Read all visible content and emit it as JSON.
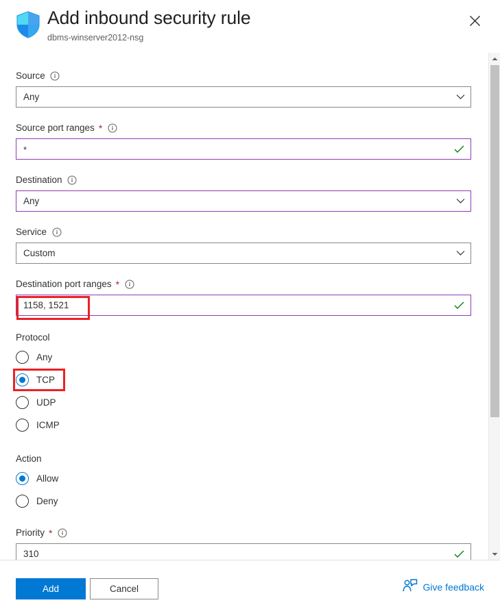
{
  "header": {
    "title": "Add inbound security rule",
    "subtitle": "dbms-winserver2012-nsg",
    "shield_icon": "shield-icon",
    "close_icon": "close-icon"
  },
  "form": {
    "source": {
      "label": "Source",
      "info_icon": "info-icon",
      "value": "Any",
      "required": false,
      "accent": false,
      "chevron_icon": "chevron-down-icon"
    },
    "source_port_ranges": {
      "label": "Source port ranges",
      "required_marker": "*",
      "info_icon": "info-icon",
      "value": "*",
      "required": true,
      "accent": true,
      "valid_icon": "checkmark-icon"
    },
    "destination": {
      "label": "Destination",
      "info_icon": "info-icon",
      "value": "Any",
      "required": false,
      "accent": true,
      "chevron_icon": "chevron-down-icon"
    },
    "service": {
      "label": "Service",
      "info_icon": "info-icon",
      "value": "Custom",
      "required": false,
      "accent": false,
      "chevron_icon": "chevron-down-icon"
    },
    "destination_port_ranges": {
      "label": "Destination port ranges",
      "required_marker": "*",
      "info_icon": "info-icon",
      "value": "1158, 1521",
      "required": true,
      "accent": true,
      "valid_icon": "checkmark-icon",
      "highlighted": true
    },
    "protocol": {
      "label": "Protocol",
      "selected": "TCP",
      "options": [
        {
          "label": "Any",
          "selected": false,
          "highlighted": false
        },
        {
          "label": "TCP",
          "selected": true,
          "highlighted": true
        },
        {
          "label": "UDP",
          "selected": false,
          "highlighted": false
        },
        {
          "label": "ICMP",
          "selected": false,
          "highlighted": false
        }
      ]
    },
    "action": {
      "label": "Action",
      "selected": "Allow",
      "options": [
        {
          "label": "Allow",
          "selected": true
        },
        {
          "label": "Deny",
          "selected": false
        }
      ]
    },
    "priority": {
      "label": "Priority",
      "required_marker": "*",
      "info_icon": "info-icon",
      "value": "310",
      "required": true,
      "accent": false,
      "valid_icon": "checkmark-icon"
    }
  },
  "scrollbar": {
    "up_icon": "scroll-up-arrow-icon",
    "down_icon": "scroll-down-arrow-icon"
  },
  "footer": {
    "add_label": "Add",
    "cancel_label": "Cancel",
    "feedback_label": "Give feedback",
    "feedback_icon": "person-feedback-icon"
  },
  "colors": {
    "accent_blue": "#0078d4",
    "field_accent_purple": "#8c3bb0",
    "valid_green": "#107c10",
    "required_red": "#a4262c",
    "annotation_red": "#ec2024"
  }
}
